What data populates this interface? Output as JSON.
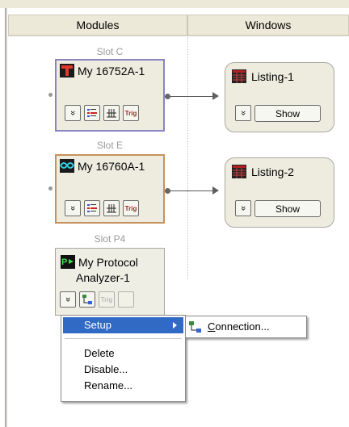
{
  "columns": {
    "modules": "Modules",
    "windows": "Windows"
  },
  "slots": [
    {
      "label": "Slot C",
      "module": {
        "name": "My 16752A-1",
        "icon": "trigger-t-icon",
        "border_color": "#8a84c0"
      }
    },
    {
      "label": "Slot E",
      "module": {
        "name": "My 16760A-1",
        "icon": "eye-diagram-icon",
        "border_color": "#c6925a"
      }
    },
    {
      "label": "Slot P4",
      "module": {
        "name_line1": "My Protocol",
        "name_line2": "Analyzer-1",
        "icon": "protocol-p-icon"
      }
    }
  ],
  "module_buttons": {
    "expand": "»",
    "trig": "Trig"
  },
  "windows": [
    {
      "name": "Listing-1",
      "icon": "listing-table-icon",
      "show_label": "Show"
    },
    {
      "name": "Listing-2",
      "icon": "listing-table-icon",
      "show_label": "Show"
    }
  ],
  "context_menu": {
    "items": [
      "Setup",
      "Delete",
      "Disable...",
      "Rename..."
    ],
    "selected": "Setup",
    "submenu": {
      "label_accel": "C",
      "label_rest": "onnection..."
    }
  },
  "colors": {
    "menu_highlight": "#316ac5",
    "panel_bg": "#edecdf",
    "header_bg": "#ece9d8"
  }
}
